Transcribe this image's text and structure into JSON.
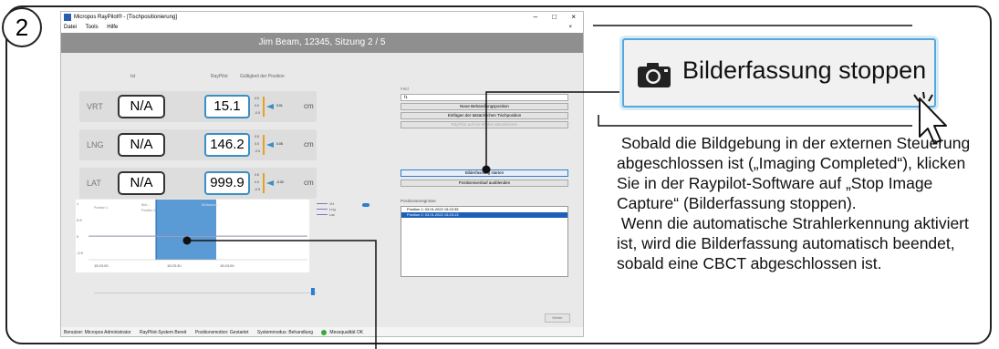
{
  "step_number": "2",
  "window": {
    "title": "Micropos RayPilot® - [Tischpositionierung]",
    "controls": [
      "–",
      "□",
      "×"
    ]
  },
  "menu": {
    "items": [
      "Datei",
      "Tools",
      "Hilfe"
    ],
    "close": "×"
  },
  "header": {
    "patient": "Jim Beam, 12345, Sitzung 2 / 5"
  },
  "columns": {
    "ist": "Ist",
    "raypilot": "RayPilot",
    "guete": "Gültigkeit der Position"
  },
  "rows": [
    {
      "label": "VRT",
      "ist": "N/A",
      "raypilot": "15.1",
      "unit": "cm",
      "ticks": [
        "0.5",
        "0.0",
        "-0.5"
      ],
      "delta": "0.01"
    },
    {
      "label": "LNG",
      "ist": "N/A",
      "raypilot": "146.2",
      "unit": "cm",
      "ticks": [
        "0.5",
        "0.0",
        "-0.5"
      ],
      "delta": "0.05"
    },
    {
      "label": "LAT",
      "ist": "N/A",
      "raypilot": "999.9",
      "unit": "cm",
      "ticks": [
        "0.5",
        "0.0",
        "-0.5"
      ],
      "delta": "-0.02"
    }
  ],
  "chart": {
    "y_ticks": [
      "1",
      "0.5",
      "0",
      "-0.5"
    ],
    "x_ticks": [
      "15:23:00",
      "15:23:30",
      "15:24:00"
    ],
    "labels": [
      "Position 1",
      "Bild...",
      "Position 2",
      "Bildfassung"
    ],
    "legend": [
      "Vrt",
      "Lng",
      "Lat"
    ]
  },
  "right_panel": {
    "feld_label": "Feld",
    "feld_value": "f1",
    "buttons": [
      "Neue Behandlungsposition",
      "Einfügen der tatsächlichen Tischposition",
      "RayPilot auf ein Winkel aktualisieren"
    ],
    "start_capture": "Bilderfassung starten",
    "hide_course": "Positionsverlauf ausblenden",
    "events_label": "Positionsereignisse",
    "events": [
      "Position 1: 03.01.2022 15:22:35",
      "Position 2: 03.01.2022 15:23:13"
    ],
    "weiter": "Weiter"
  },
  "status": {
    "user": "Benutzer: Micropos Administrator",
    "system": "RayPilot-System Bereit",
    "positioning": "Positionsmotion: Gestartet",
    "mode": "Systemmodus: Behandlung",
    "quality": "Messqualität OK"
  },
  "callout": {
    "button_label": "Bilderfassung stoppen",
    "icon": "camera-icon",
    "paragraph1": " Sobald die Bildgebung in der externen Steuerung abgeschlossen ist („Imaging Completed“), klicken Sie in der Raypilot-Software auf „Stop Image Capture“ (Bilderfassung stoppen).",
    "paragraph2": " Wenn die automatische Strahlerkennung aktiviert ist, wird die Bilderfassung automatisch beendet, sobald eine CBCT abgeschlossen ist."
  },
  "colors": {
    "accent": "#2a7fd0",
    "callout_border": "#55a8dc",
    "selection_fill": "#5b9bd5"
  }
}
